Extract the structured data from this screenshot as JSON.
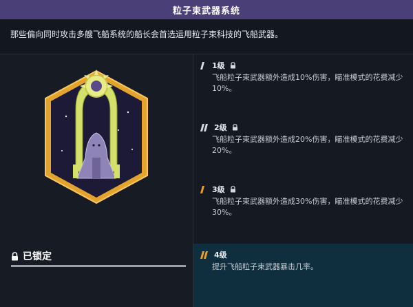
{
  "title": "粒子束武器系统",
  "description": "那些偏向同时攻击多艘飞船系统的船长会首选运用粒子束科技的飞船武器。",
  "status": {
    "label": "已锁定",
    "icon": "lock-icon"
  },
  "levels": [
    {
      "label": "1级",
      "text": "飞船粒子束武器额外造成10%伤害，瞄准模式的花费减少10%。",
      "locked": true
    },
    {
      "label": "2级",
      "text": "飞船粒子束武器额外造成20%伤害，瞄准模式的花费减少20%。",
      "locked": true
    },
    {
      "label": "3级",
      "text": "飞船粒子束武器额外造成30%伤害，瞄准模式的花费减少30%。",
      "locked": true
    },
    {
      "label": "4级",
      "text": "提升飞船粒子束武器暴击几率。",
      "locked": false
    }
  ],
  "colors": {
    "accent": "#f0a020",
    "title_bg": "#4b3f78",
    "highlight_bg": "#0f2f3f"
  }
}
